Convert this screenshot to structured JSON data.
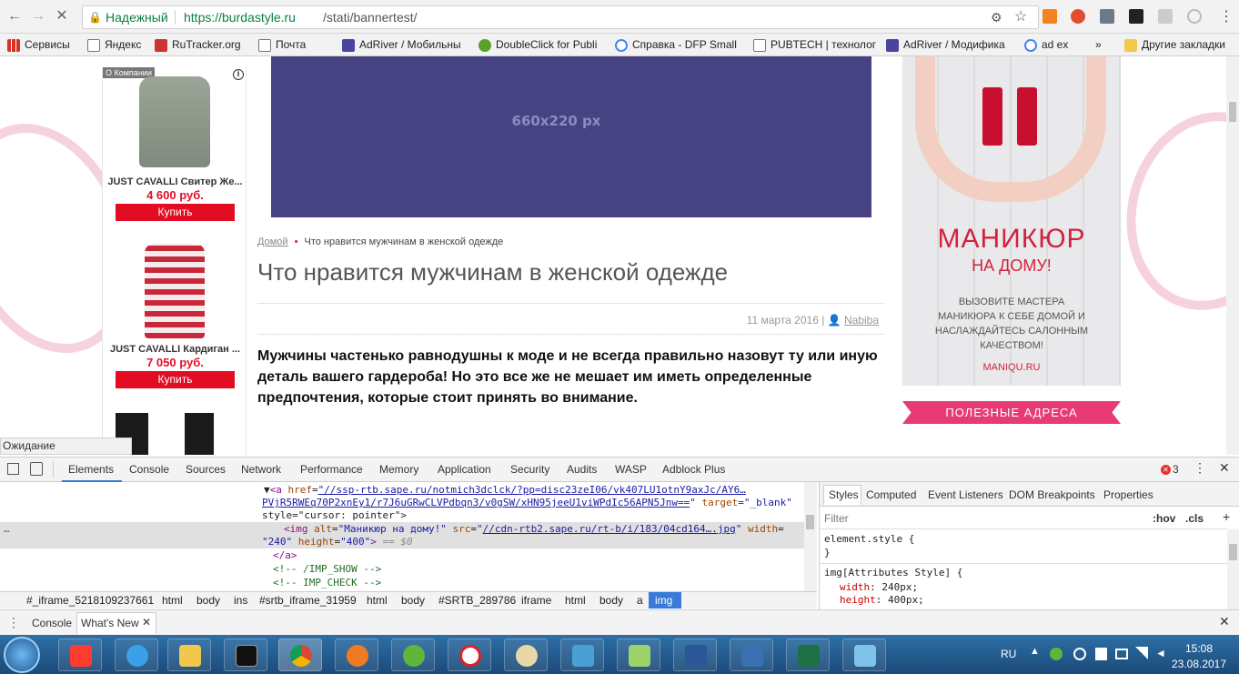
{
  "browser": {
    "secure_label": "Надежный",
    "url_domain": "https://burdastyle.ru",
    "url_path": "/stati/bannertest/",
    "bookmarks": [
      "Сервисы",
      "Яндекс",
      "RuTracker.org",
      "Почта",
      "AdRiver / Мобильны",
      "DoubleClick for Publi",
      "Справка - DFP Small",
      "PUBTECH | технолог",
      "AdRiver / Модифика",
      "ad ex"
    ],
    "overflow": "»",
    "other_bookmarks": "Другие закладки"
  },
  "page": {
    "products_badge": "О Компании",
    "products": [
      {
        "name": "JUST CAVALLI Свитер Же...",
        "price": "4 600 руб.",
        "buy": "Купить"
      },
      {
        "name": "JUST CAVALLI Кардиган ...",
        "price": "7 050 руб.",
        "buy": "Купить"
      }
    ],
    "banner_size": "660x220 px",
    "breadcrumb_home": "Домой",
    "breadcrumb_sep": "•",
    "breadcrumb_current": "Что нравится мужчинам в женской одежде",
    "title": "Что нравится мужчинам в женской одежде",
    "date": "11 марта 2016 |",
    "author": "Nabiba",
    "lead": "Мужчины частенько равнодушны к моде и не всегда правильно назовут ту или иную деталь вашего гардероба! Но это все же не мешает им иметь определенные предпочтения, которые стоит принять во внимание.",
    "ad_title": "МАНИКЮР",
    "ad_subtitle": "НА ДОМУ!",
    "ad_text": "ВЫЗОВИТЕ МАСТЕРА МАНИКЮРА К СЕБЕ ДОМОЙ И НАСЛАЖДАЙТЕСЬ САЛОННЫМ КАЧЕСТВОМ!",
    "ad_link": "MANIQU.RU",
    "useful_addresses": "ПОЛЕЗНЫЕ АДРЕСА"
  },
  "status_text": "Ожидание mc.yandex.ru...",
  "devtools": {
    "tabs": [
      "Elements",
      "Console",
      "Sources",
      "Network",
      "Performance",
      "Memory",
      "Application",
      "Security",
      "Audits",
      "WASP",
      "Adblock Plus"
    ],
    "error_count": "3",
    "dom_lines": {
      "a_href": "\"//ssp-rtb.sape.ru/notmich3dclck/?pp=disc23zeI06/vk407LU1otnY9axJc/AY6…",
      "a_href2": "PVjR5RWEq70P2xnEy1/r7J6uGRwCLVPdbqn3/v0gSW/xHN95jeeU1viWPdIc56APN5Jnw==",
      "a_target": "\"_blank\"",
      "a_style": "style=\"cursor: pointer\">",
      "img_alt": "\"Маникюр на дому!\"",
      "img_src": "//cdn-rtb2.sape.ru/rt-b/i/183/04cd164….jpg",
      "img_width": "\"240\"",
      "img_height": "\"400\"",
      "img_eq": "== $0",
      "close_a": "</a>",
      "c1": "<!-- /IMP_SHOW -->",
      "c2": "<!-- IMP_CHECK -->"
    },
    "breadcrumbs": [
      "#_iframe_5218109237661",
      "html",
      "body",
      "ins",
      "#srtb_iframe_31959",
      "html",
      "body",
      "#SRTB_289786",
      "iframe",
      "html",
      "body",
      "a",
      "img"
    ],
    "styles_tabs": [
      "Styles",
      "Computed",
      "Event Listeners",
      "DOM Breakpoints",
      "Properties"
    ],
    "filter": "Filter",
    "hov": ":hov",
    "cls": ".cls",
    "rule1": "element.style {",
    "rule1_close": "}",
    "rule2": "img[Attributes Style] {",
    "prop_width": "width",
    "val_width": "240px;",
    "prop_height": "height",
    "val_height": "400px;",
    "drawer_tabs": [
      "Console",
      "What's New"
    ]
  },
  "taskbar": {
    "lang": "RU",
    "time": "15:08",
    "date": "23.08.2017"
  }
}
